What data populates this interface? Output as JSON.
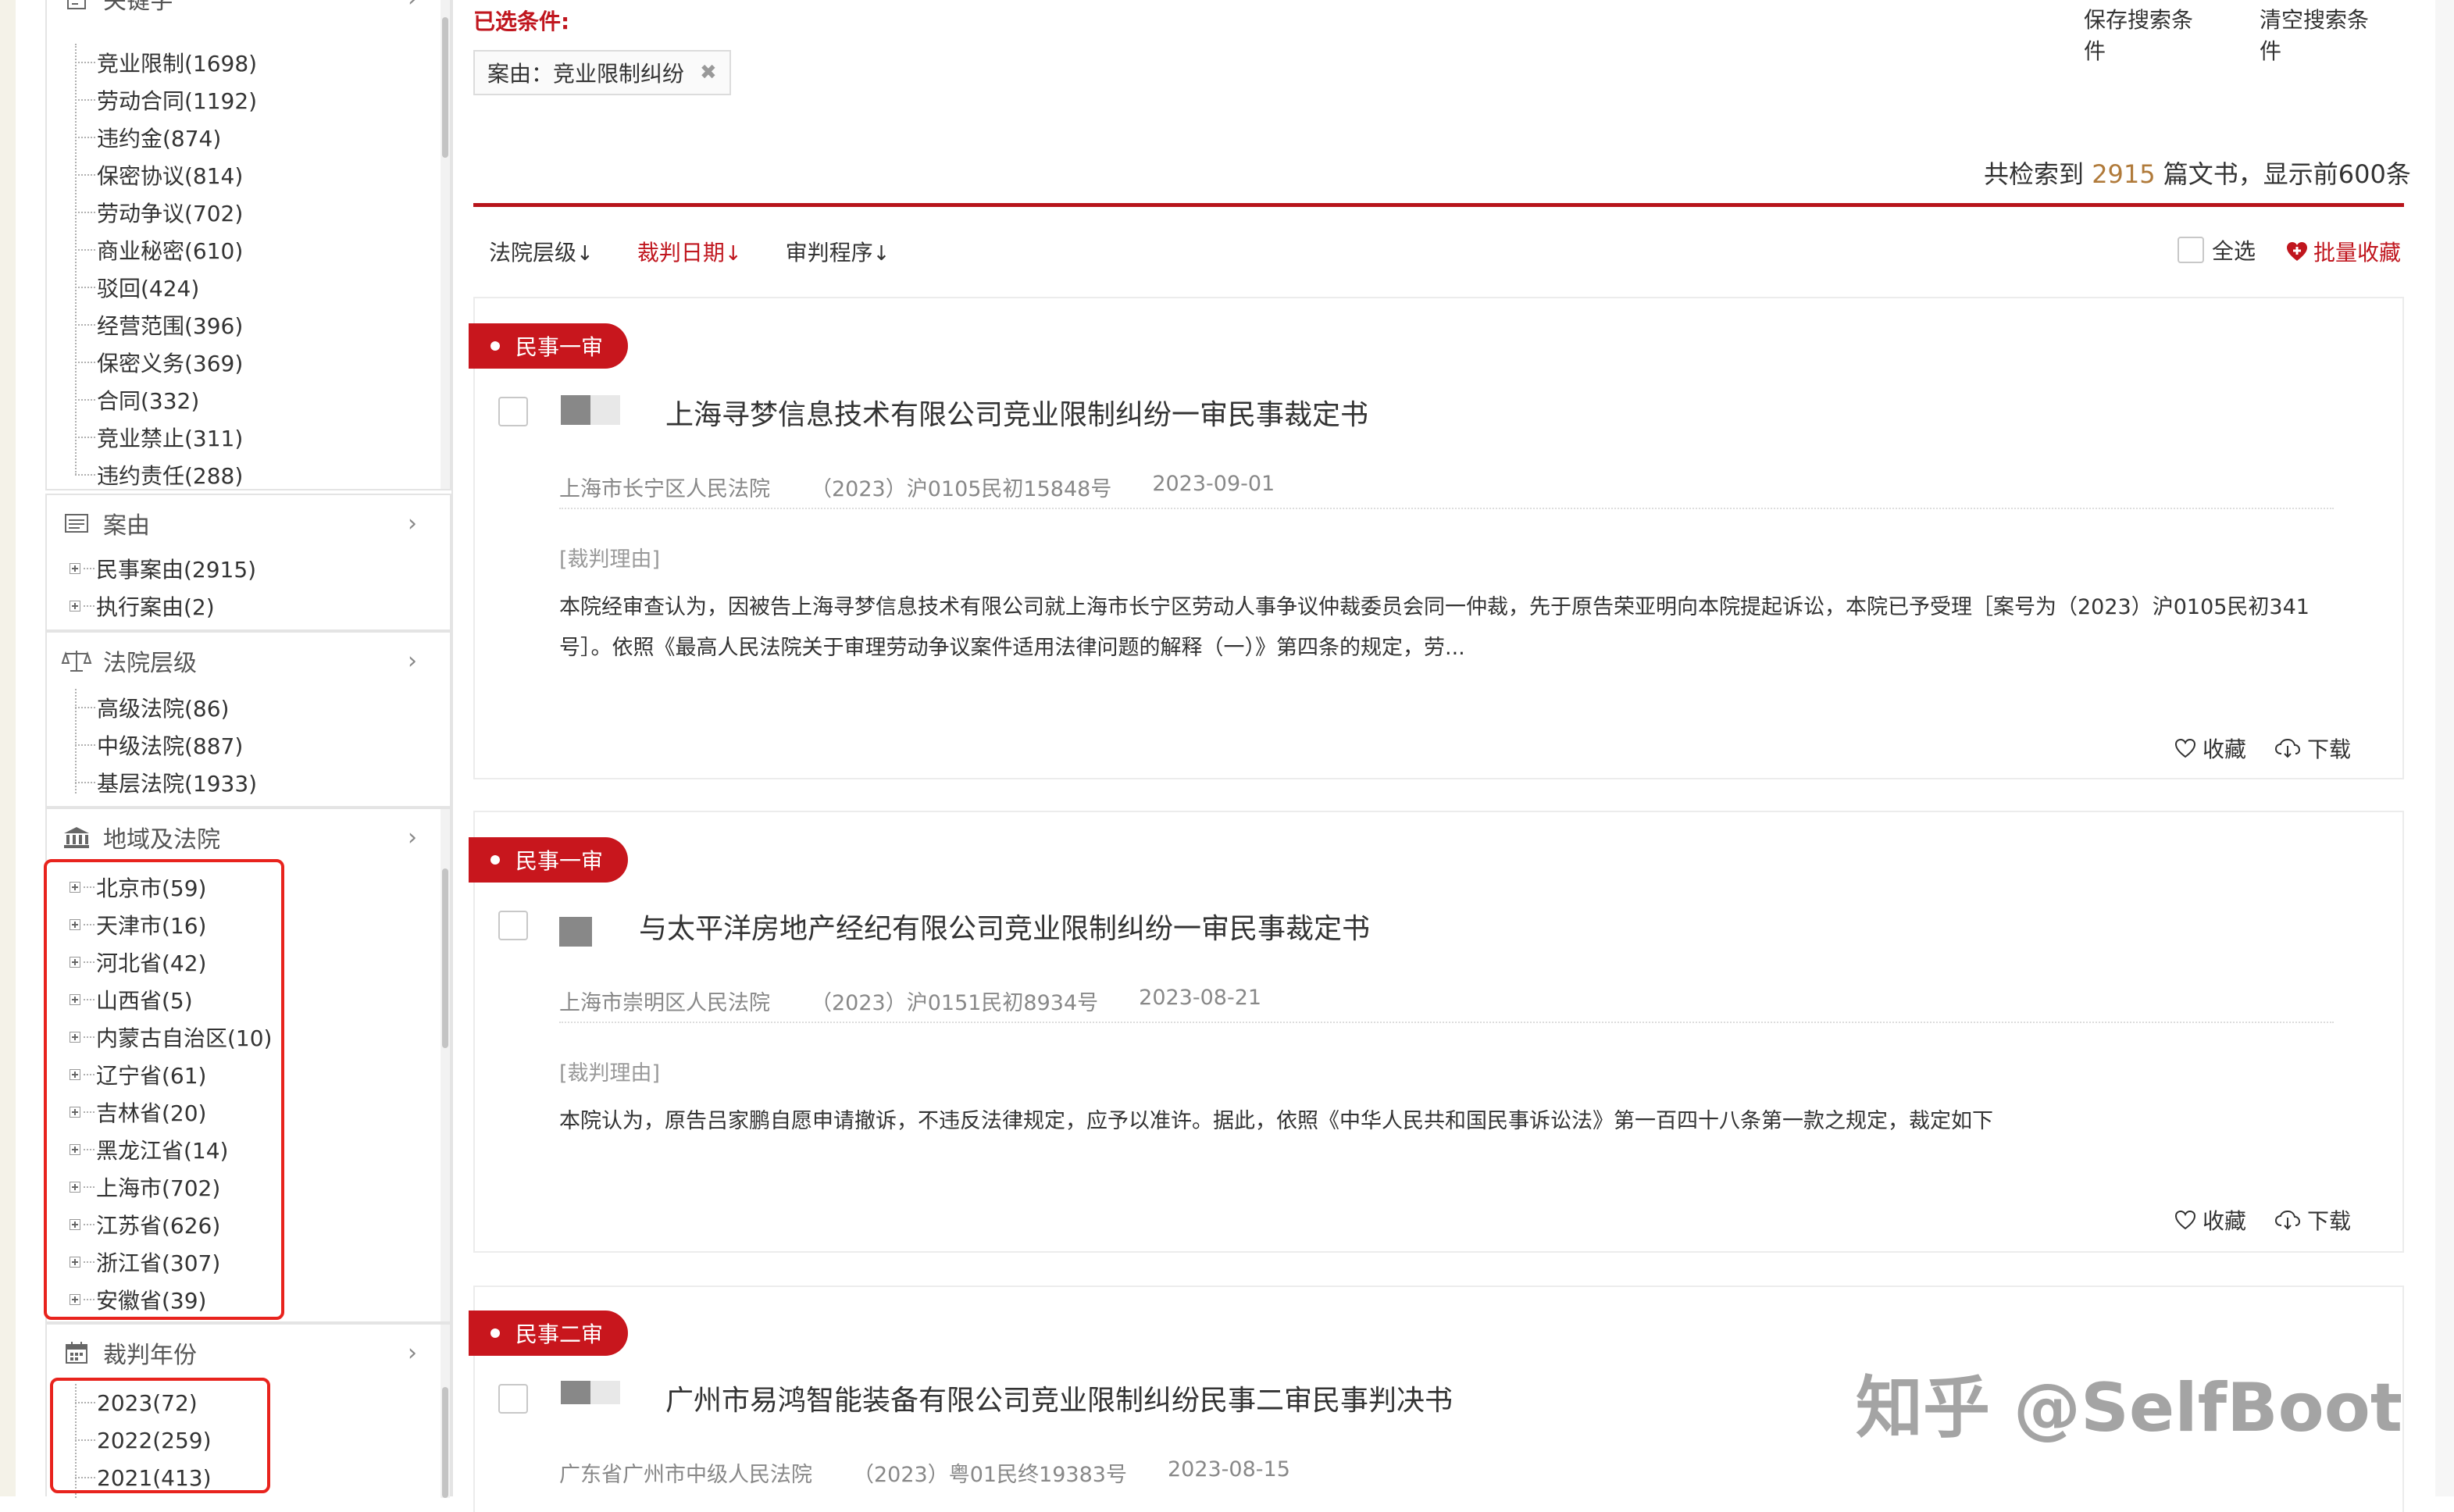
{
  "sidebar": {
    "keywords": {
      "title": "关键字",
      "items": [
        "竞业限制(1698)",
        "劳动合同(1192)",
        "违约金(874)",
        "保密协议(814)",
        "劳动争议(702)",
        "商业秘密(610)",
        "驳回(424)",
        "经营范围(396)",
        "保密义务(369)",
        "合同(332)",
        "竞业禁止(311)",
        "违约责任(288)"
      ]
    },
    "cause": {
      "title": "案由",
      "items": [
        "民事案由(2915)",
        "执行案由(2)"
      ]
    },
    "court_level": {
      "title": "法院层级",
      "items": [
        "高级法院(86)",
        "中级法院(887)",
        "基层法院(1933)"
      ]
    },
    "region": {
      "title": "地域及法院",
      "items": [
        "北京市(59)",
        "天津市(16)",
        "河北省(42)",
        "山西省(5)",
        "内蒙古自治区(10)",
        "辽宁省(61)",
        "吉林省(20)",
        "黑龙江省(14)",
        "上海市(702)",
        "江苏省(626)",
        "浙江省(307)",
        "安徽省(39)"
      ]
    },
    "year": {
      "title": "裁判年份",
      "items": [
        "2023(72)",
        "2022(259)",
        "2021(413)"
      ]
    }
  },
  "main": {
    "selected_label": "已选条件:",
    "save_search": "保存搜索条件",
    "clear_search": "清空搜索条件",
    "chip_label": "案由：竞业限制纠纷",
    "chip_close": "✖",
    "result_prefix": "共检索到",
    "result_count": "2915",
    "result_suffix": "篇文书，显示前600条",
    "sort": {
      "court_level": "法院层级",
      "judge_date": "裁判日期",
      "procedure": "审判程序",
      "arrow": "↓"
    },
    "select_all": "全选",
    "batch_collect": "批量收藏",
    "collect": "收藏",
    "download": "下载",
    "cards": [
      {
        "tag": "民事一审",
        "title": "上海寻梦信息技术有限公司竞业限制纠纷一审民事裁定书",
        "court": "上海市长宁区人民法院",
        "case_no": "（2023）沪0105民初15848号",
        "date": "2023-09-01",
        "reason_label": "[裁判理由]",
        "reason": "本院经审查认为，因被告上海寻梦信息技术有限公司就上海市长宁区劳动人事争议仲裁委员会同一仲裁，先于原告荣亚明向本院提起诉讼，本院已予受理［案号为（2023）沪0105民初341号］。依照《最高人民法院关于审理劳动争议案件适用法律问题的解释（一）》第四条的规定，劳..."
      },
      {
        "tag": "民事一审",
        "title": "与太平洋房地产经纪有限公司竞业限制纠纷一审民事裁定书",
        "court": "上海市崇明区人民法院",
        "case_no": "（2023）沪0151民初8934号",
        "date": "2023-08-21",
        "reason_label": "[裁判理由]",
        "reason": "本院认为，原告吕家鹏自愿申请撤诉，不违反法律规定，应予以准许。据此，依照《中华人民共和国民事诉讼法》第一百四十八条第一款之规定，裁定如下"
      },
      {
        "tag": "民事二审",
        "title": "广州市易鸿智能装备有限公司竞业限制纠纷民事二审民事判决书",
        "court": "广东省广州市中级人民法院",
        "case_no": "（2023）粤01民终19383号",
        "date": "2023-08-15"
      }
    ],
    "watermark": "知乎 @SelfBoot"
  },
  "colors": {
    "accent_red": "#c8161d",
    "highlight_red": "#e8231d",
    "count_brown": "#b07a3a"
  }
}
